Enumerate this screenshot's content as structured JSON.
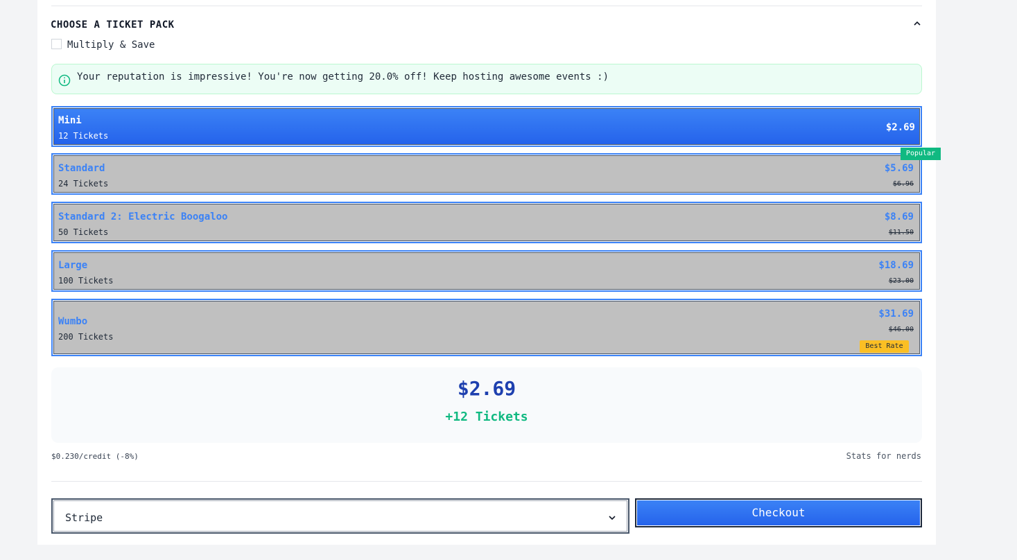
{
  "section": {
    "title": "CHOOSE A TICKET PACK",
    "collapse_icon": "chevron-up-icon"
  },
  "multiply": {
    "label": "Multiply & Save",
    "checked": false
  },
  "notice": {
    "icon": "info-icon",
    "text": "Your reputation is impressive! You're now getting 20.0% off! Keep hosting awesome events :)",
    "color": "#10b981"
  },
  "packs": [
    {
      "name": "Mini",
      "tickets": "12 Tickets",
      "price": "$2.69",
      "old_price": "",
      "selected": true
    },
    {
      "name": "Standard",
      "tickets": "24 Tickets",
      "price": "$5.69",
      "old_price": "$6.96",
      "badge": "Popular"
    },
    {
      "name": "Standard 2: Electric Boogaloo",
      "tickets": "50 Tickets",
      "price": "$8.69",
      "old_price": "$11.50"
    },
    {
      "name": "Large",
      "tickets": "100 Tickets",
      "price": "$18.69",
      "old_price": "$23.00"
    },
    {
      "name": "Wumbo",
      "tickets": "200 Tickets",
      "price": "$31.69",
      "old_price": "$46.00",
      "badge": "Best Rate"
    }
  ],
  "summary": {
    "price": "$2.69",
    "tickets": "+12 Tickets"
  },
  "stats": {
    "rate": "$0.230/credit",
    "discount": "(-8%)",
    "link": "Stats for nerds"
  },
  "payment": {
    "selected": "Stripe",
    "select_icon": "chevron-down-icon"
  },
  "checkout": {
    "label": "Checkout"
  },
  "colors": {
    "accent": "#3b82f6",
    "popular": "#10b981",
    "best_rate": "#fbbf24",
    "summary_price": "#1e40af"
  }
}
